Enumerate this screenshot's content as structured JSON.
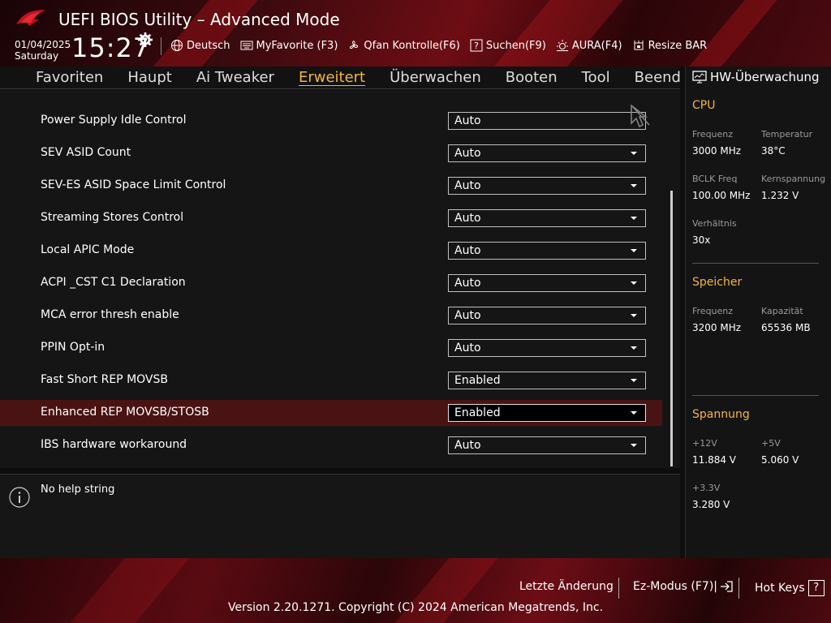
{
  "header": {
    "title": "UEFI BIOS Utility – Advanced Mode",
    "date": "01/04/2025",
    "day": "Saturday",
    "time": "15:27",
    "toolbar": [
      {
        "label": "Deutsch",
        "icon": "globe-icon"
      },
      {
        "label": "MyFavorite (F3)",
        "icon": "keyboard-icon"
      },
      {
        "label": "Qfan Kontrolle(F6)",
        "icon": "fan-icon"
      },
      {
        "label": "Suchen(F9)",
        "icon": "search-icon"
      },
      {
        "label": "AURA(F4)",
        "icon": "aura-icon"
      },
      {
        "label": "Resize BAR",
        "icon": "resize-bar-icon"
      }
    ]
  },
  "nav": {
    "tabs": [
      "Favoriten",
      "Haupt",
      "Ai Tweaker",
      "Erweitert",
      "Überwachen",
      "Booten",
      "Tool",
      "Beend"
    ],
    "active": "Erweitert"
  },
  "settings": {
    "rows": [
      {
        "label": "Power Supply Idle Control",
        "value": "Auto"
      },
      {
        "label": "SEV ASID Count",
        "value": "Auto"
      },
      {
        "label": "SEV-ES ASID Space Limit Control",
        "value": "Auto"
      },
      {
        "label": "Streaming Stores Control",
        "value": "Auto"
      },
      {
        "label": "Local APIC Mode",
        "value": "Auto"
      },
      {
        "label": "ACPI _CST C1 Declaration",
        "value": "Auto"
      },
      {
        "label": "MCA error thresh enable",
        "value": "Auto"
      },
      {
        "label": "PPIN Opt-in",
        "value": "Auto"
      },
      {
        "label": "Fast Short REP MOVSB",
        "value": "Enabled"
      },
      {
        "label": "Enhanced REP MOVSB/STOSB",
        "value": "Enabled",
        "selected": true
      },
      {
        "label": "IBS hardware workaround",
        "value": "Auto"
      }
    ]
  },
  "help": {
    "text": "No help string"
  },
  "hw": {
    "title": "HW-Überwachung",
    "cpu": {
      "heading": "CPU",
      "freq_label": "Frequenz",
      "freq_value": "3000 MHz",
      "temp_label": "Temperatur",
      "temp_value": "38°C",
      "bclk_label": "BCLK Freq",
      "bclk_value": "100.00 MHz",
      "core_label": "Kernspannung",
      "core_value": "1.232 V",
      "ratio_label": "Verhältnis",
      "ratio_value": "30x"
    },
    "memory": {
      "heading": "Speicher",
      "freq_label": "Frequenz",
      "freq_value": "3200 MHz",
      "cap_label": "Kapazität",
      "cap_value": "65536 MB"
    },
    "voltage": {
      "heading": "Spannung",
      "v12_label": "+12V",
      "v12_value": "11.884 V",
      "v5_label": "+5V",
      "v5_value": "5.060 V",
      "v33_label": "+3.3V",
      "v33_value": "3.280 V"
    }
  },
  "footer": {
    "last_change": "Letzte Änderung",
    "ez_mode": "Ez-Modus (F7)|",
    "hot_keys": "Hot Keys",
    "hot_keys_glyph": "?",
    "copyright": "Version 2.20.1271. Copyright (C) 2024 American Megatrends, Inc."
  }
}
